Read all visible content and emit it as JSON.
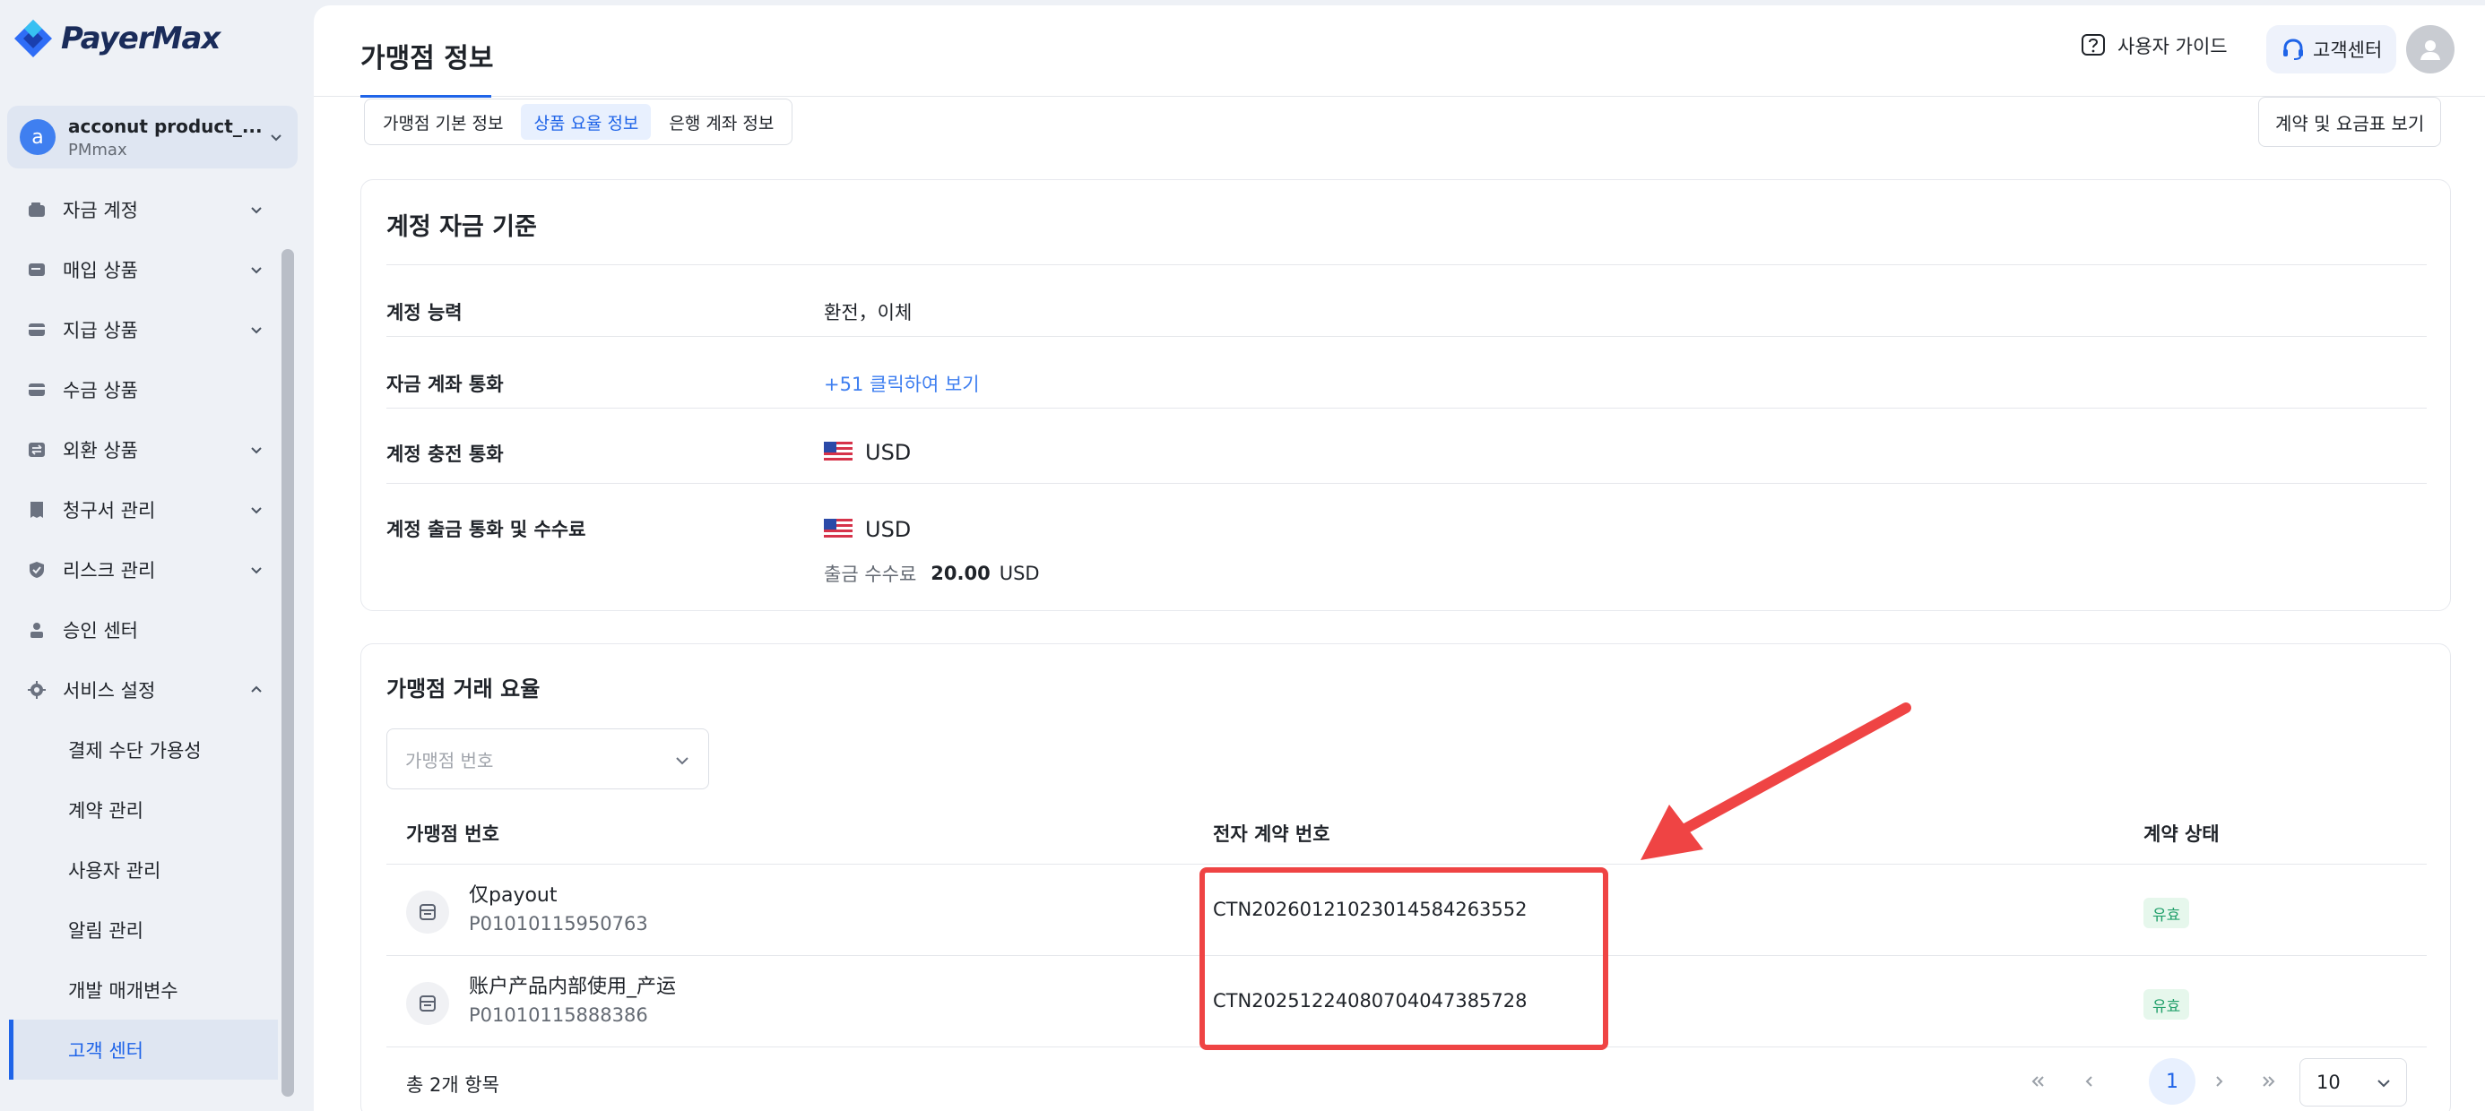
{
  "brand": {
    "name": "PayerMax"
  },
  "account": {
    "avatar_letter": "a",
    "name": "acconut product_...",
    "sub": "PMmax"
  },
  "sidebar": {
    "items": [
      {
        "label": "자금 계정",
        "icon": "wallet-icon",
        "expandable": true
      },
      {
        "label": "매입 상품",
        "icon": "card-icon",
        "expandable": true
      },
      {
        "label": "지급 상품",
        "icon": "payout-icon",
        "expandable": true
      },
      {
        "label": "수금 상품",
        "icon": "collect-icon",
        "expandable": false
      },
      {
        "label": "외환 상품",
        "icon": "exchange-icon",
        "expandable": true
      },
      {
        "label": "청구서 관리",
        "icon": "invoice-icon",
        "expandable": true
      },
      {
        "label": "리스크 관리",
        "icon": "shield-icon",
        "expandable": true
      },
      {
        "label": "승인 센터",
        "icon": "approval-icon",
        "expandable": false
      },
      {
        "label": "서비스 설정",
        "icon": "gear-icon",
        "expandable": true,
        "expanded": true
      }
    ],
    "sub_items": [
      "결제 수단 가용성",
      "계약 관리",
      "사용자 관리",
      "알림 관리",
      "개발 매개변수",
      "고객 센터"
    ],
    "active_sub": "고객 센터"
  },
  "header": {
    "title": "가맹점 정보",
    "guide_label": "사용자 가이드",
    "cs_label": "고객센터"
  },
  "tabs": [
    "가맹점 기본 정보",
    "상품 요율 정보",
    "은행 계좌 정보"
  ],
  "active_tab": "상품 요율 정보",
  "view_button": "계약 및 요금표 보기",
  "account_funds": {
    "title": "계정 자금 기준",
    "rows": [
      {
        "label": "계정 능력",
        "value": "환전，이체"
      },
      {
        "label": "자금 계좌 통화",
        "value": "+51 클릭하여 보기"
      },
      {
        "label": "계정 충전 통화",
        "value": "USD"
      },
      {
        "label": "계정 출금 통화 및 수수료",
        "value": "USD"
      }
    ],
    "fee_label": "출금 수수료",
    "fee_amount": "20.00",
    "fee_currency": "USD"
  },
  "merchant_rates": {
    "title": "가맹점 거래 요율",
    "select_placeholder": "가맹점 번호",
    "columns": [
      "가맹점 번호",
      "전자 계약 번호",
      "계약 상태"
    ],
    "rows": [
      {
        "name": "仅payout",
        "id": "P01010115950763",
        "contract": "CTN20260121023014584263552",
        "status": "유효"
      },
      {
        "name": "账户产品内部使用_产运",
        "id": "P01010115888386",
        "contract": "CTN20251224080704047385728",
        "status": "유효"
      }
    ],
    "total": "총 2개 항목",
    "current_page": "1",
    "page_size": "10"
  },
  "colors": {
    "accent": "#1f64e8",
    "link": "#3f7ff0",
    "success": "#22a06b",
    "annotation": "#ef4444"
  }
}
